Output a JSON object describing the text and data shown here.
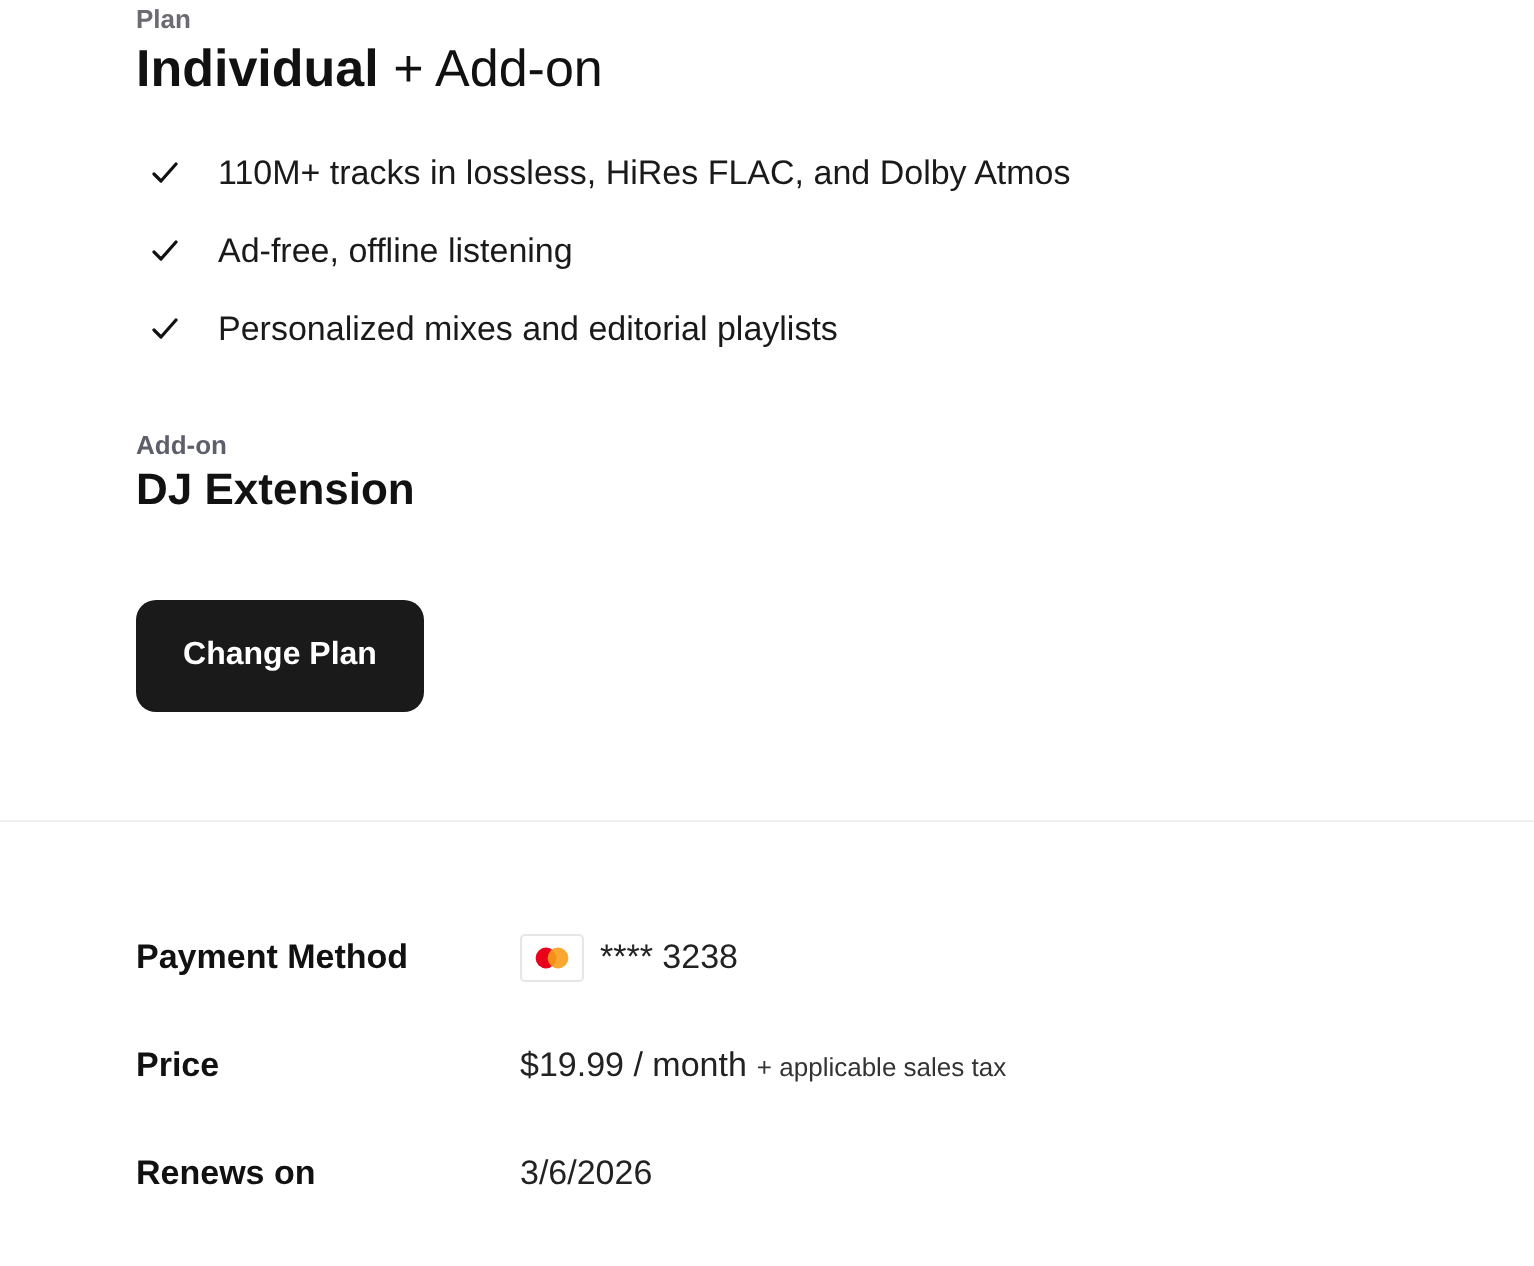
{
  "plan": {
    "label": "Plan",
    "title": "**Individual** + Add-on",
    "features": [
      "110M+ tracks in lossless, HiRes FLAC, and Dolby Atmos",
      "Ad-free, offline listening",
      "Personalized mixes and editorial playlists"
    ]
  },
  "addon": {
    "label": "Add-on",
    "name": "DJ Extension"
  },
  "change_plan_button": "Change Plan",
  "details": [
    {
      "kind": "card",
      "label": "Payment Method",
      "value": "**** 3238"
    },
    {
      "kind": "price",
      "label": "Price",
      "value": "$19.99 / month",
      "note": "+ applicable sales tax"
    },
    {
      "kind": "text",
      "label": "Renews on",
      "value": "3/6/2026"
    }
  ]
}
